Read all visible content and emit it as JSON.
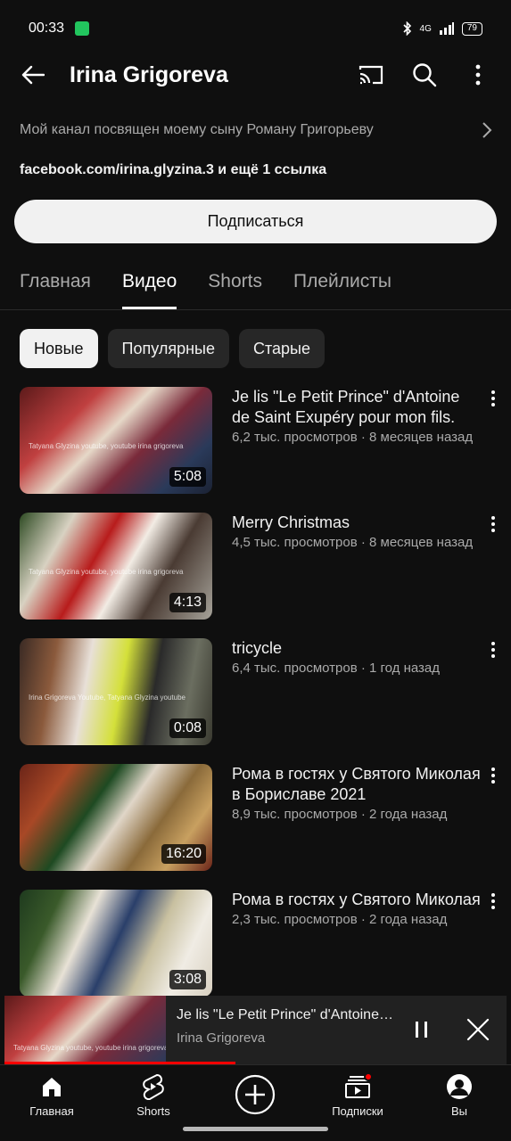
{
  "status": {
    "time": "00:33",
    "battery": "79",
    "network": "4G"
  },
  "header": {
    "title": "Irina Grigoreva"
  },
  "channel": {
    "description": "Мой канал посвящен моему сыну Роману Григорьеву",
    "links": "facebook.com/irina.glyzina.3 и ещё 1 ссылка",
    "subscribe_label": "Подписаться"
  },
  "tabs": [
    {
      "label": "Главная"
    },
    {
      "label": "Видео"
    },
    {
      "label": "Shorts"
    },
    {
      "label": "Плейлисты"
    }
  ],
  "active_tab": "Видео",
  "chips": [
    {
      "label": "Новые"
    },
    {
      "label": "Популярные"
    },
    {
      "label": "Старые"
    }
  ],
  "selected_chip": "Новые",
  "videos": [
    {
      "title": "Je lis \"Le Petit Prince\" d'Antoine de Saint Exupéry pour mon fils.",
      "stats": "6,2 тыс. просмотров · 8 месяцев назад",
      "duration": "5:08",
      "overlay": "Tatyana Glyzina youtube, youtube irina grigoreva"
    },
    {
      "title": "Merry Christmas",
      "stats": "4,5 тыс. просмотров · 8 месяцев назад",
      "duration": "4:13",
      "overlay": "Tatyana Glyzina youtube, youtube irina grigoreva"
    },
    {
      "title": "tricycle",
      "stats": "6,4 тыс. просмотров · 1 год назад",
      "duration": "0:08",
      "overlay": "Irina Grigoreva Youtube, Tatyana Glyzina youtube"
    },
    {
      "title": "Рома в гостях у Святого Миколая в Бориславе 2021",
      "stats": "8,9 тыс. просмотров · 2 года назад",
      "duration": "16:20",
      "overlay": ""
    },
    {
      "title": "Рома в гостях у Святого Миколая",
      "stats": "2,3 тыс. просмотров · 2 года назад",
      "duration": "3:08",
      "overlay": ""
    }
  ],
  "mini_player": {
    "title": "Je lis \"Le Petit Prince\" d'Antoine de Saint Exupéry pour mon fils.",
    "channel": "Irina Grigoreva",
    "overlay": "Tatyana Glyzina youtube, youtube irina grigoreva",
    "progress": 0.46
  },
  "nav": [
    {
      "label": "Главная"
    },
    {
      "label": "Shorts"
    },
    {
      "label": ""
    },
    {
      "label": "Подписки"
    },
    {
      "label": "Вы"
    }
  ],
  "colors": {
    "background": "#0f0f0f",
    "accent": "#ff0000",
    "text": "#f1f1f1",
    "muted": "#aaaaaa"
  }
}
